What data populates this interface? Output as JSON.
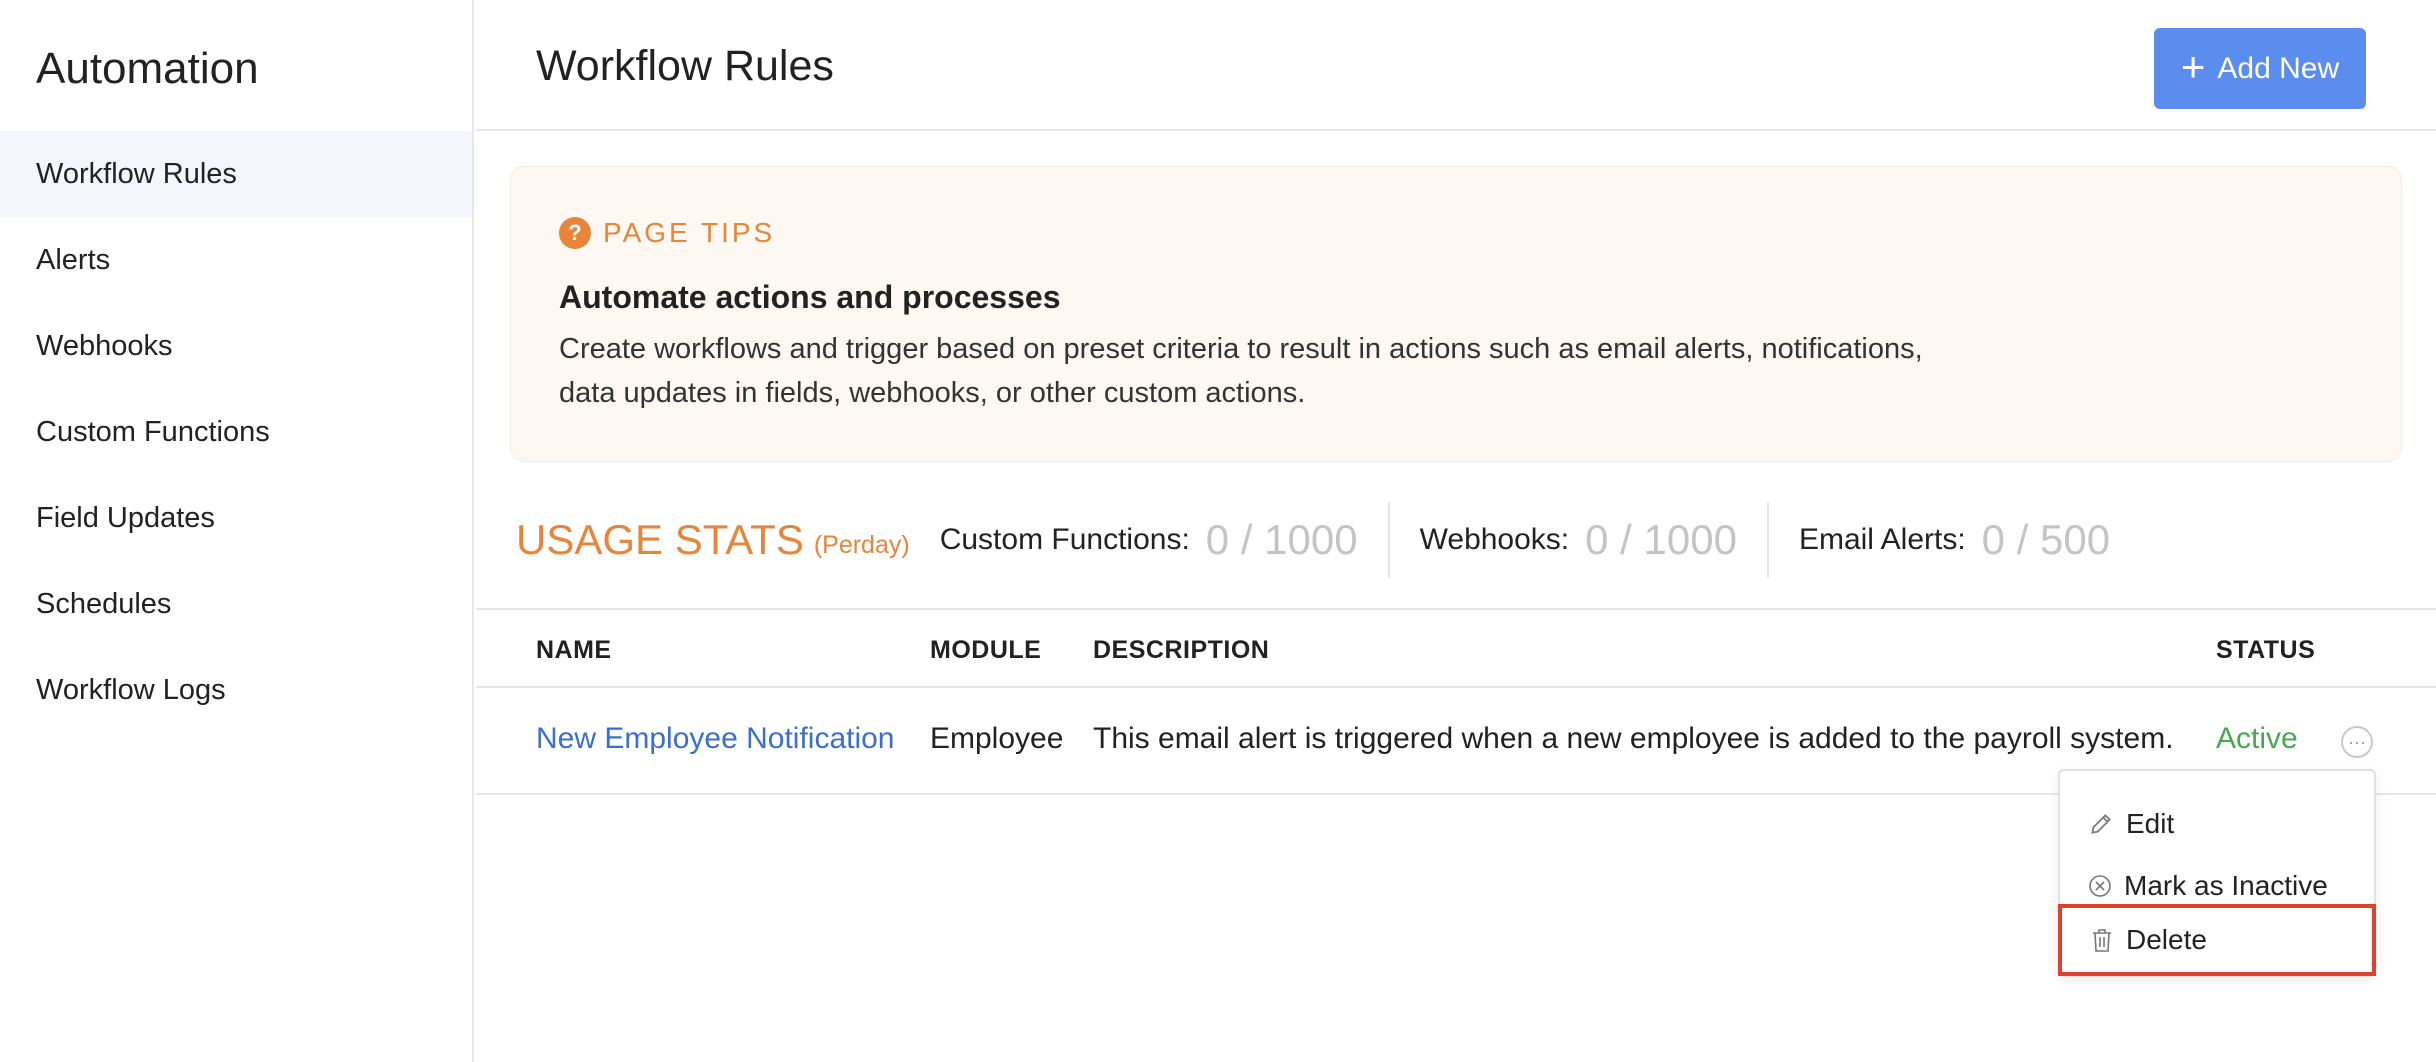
{
  "sidebar": {
    "title": "Automation",
    "items": [
      {
        "label": "Workflow Rules",
        "active": true
      },
      {
        "label": "Alerts"
      },
      {
        "label": "Webhooks"
      },
      {
        "label": "Custom Functions"
      },
      {
        "label": "Field Updates"
      },
      {
        "label": "Schedules"
      },
      {
        "label": "Workflow Logs"
      }
    ]
  },
  "header": {
    "title": "Workflow Rules",
    "add_label": "Add New",
    "add_icon": "plus-icon",
    "accent_color": "#5b8def"
  },
  "tips": {
    "label": "PAGE TIPS",
    "icon": "question-icon",
    "heading": "Automate actions and processes",
    "body_line1": "Create workflows and trigger based on preset criteria to result in actions such as email alerts, notifications,",
    "body_line2": "data updates in fields, webhooks, or other custom actions.",
    "accent_color": "#e8853b"
  },
  "usage_stats": {
    "title": "USAGE STATS",
    "subtitle": "(Perday)",
    "stats": [
      {
        "label": "Custom Functions:",
        "value": "0 / 1000"
      },
      {
        "label": "Webhooks:",
        "value": "0 / 1000"
      },
      {
        "label": "Email Alerts:",
        "value": "0 / 500"
      }
    ]
  },
  "table": {
    "columns": [
      "NAME",
      "MODULE",
      "DESCRIPTION",
      "STATUS"
    ],
    "rows": [
      {
        "name": "New Employee Notification",
        "module": "Employee",
        "description": "This email alert is triggered when a new employee is added to the payroll system.",
        "status": "Active",
        "status_color": "#48a84f"
      }
    ]
  },
  "row_menu": {
    "items": [
      {
        "label": "Edit",
        "icon": "pencil-icon"
      },
      {
        "label": "Mark as Inactive",
        "icon": "circle-x-icon"
      },
      {
        "label": "Delete",
        "icon": "trash-icon",
        "highlighted": true
      }
    ],
    "highlight_color": "#e0412e"
  }
}
